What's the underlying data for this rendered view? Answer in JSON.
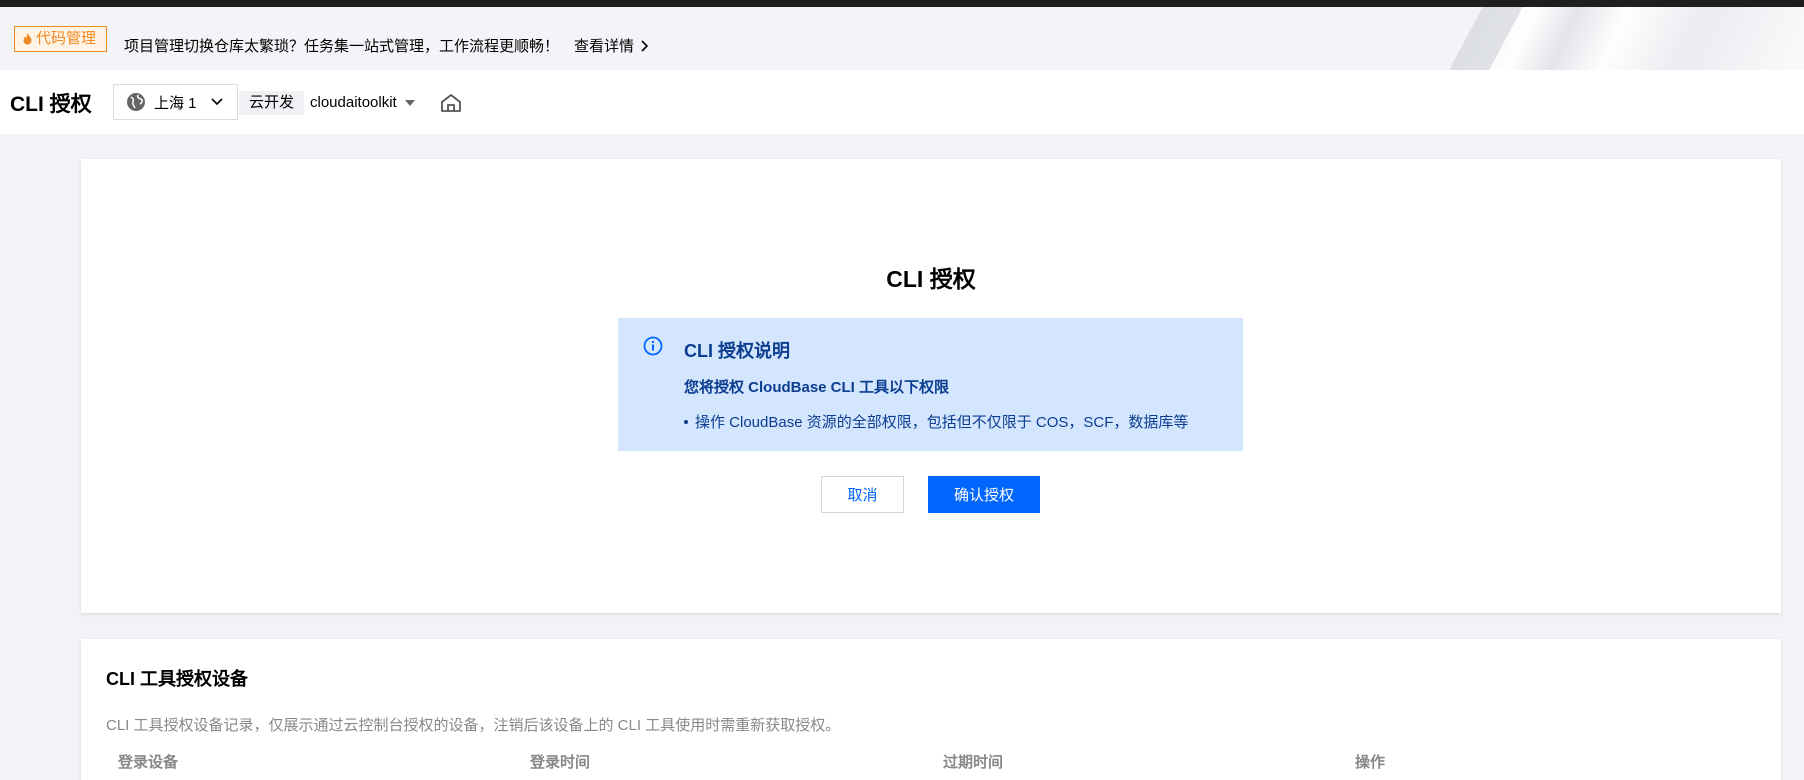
{
  "notice": {
    "badge": "代码管理",
    "text": "项目管理切换仓库太繁琐？任务集一站式管理，工作流程更顺畅！",
    "link": "查看详情"
  },
  "header": {
    "title": "CLI 授权",
    "region": "上海 1",
    "product_tag": "云开发",
    "env": "cloudaitoolkit"
  },
  "auth_card": {
    "title": "CLI 授权",
    "info": {
      "title": "CLI 授权说明",
      "subtitle": "您将授权 CloudBase CLI 工具以下权限",
      "items": [
        "操作 CloudBase 资源的全部权限，包括但不仅限于 COS，SCF，数据库等"
      ]
    },
    "cancel_label": "取消",
    "confirm_label": "确认授权"
  },
  "devices": {
    "title": "CLI 工具授权设备",
    "description": "CLI 工具授权设备记录，仅展示通过云控制台授权的设备，注销后该设备上的 CLI 工具使用时需重新获取授权。",
    "columns": [
      "登录设备",
      "登录时间",
      "过期时间",
      "操作"
    ]
  },
  "colors": {
    "accent": "#0066ff",
    "info_bg": "#d4e6fd",
    "info_text": "#0b3d91",
    "badge_orange": "#f08a24"
  }
}
